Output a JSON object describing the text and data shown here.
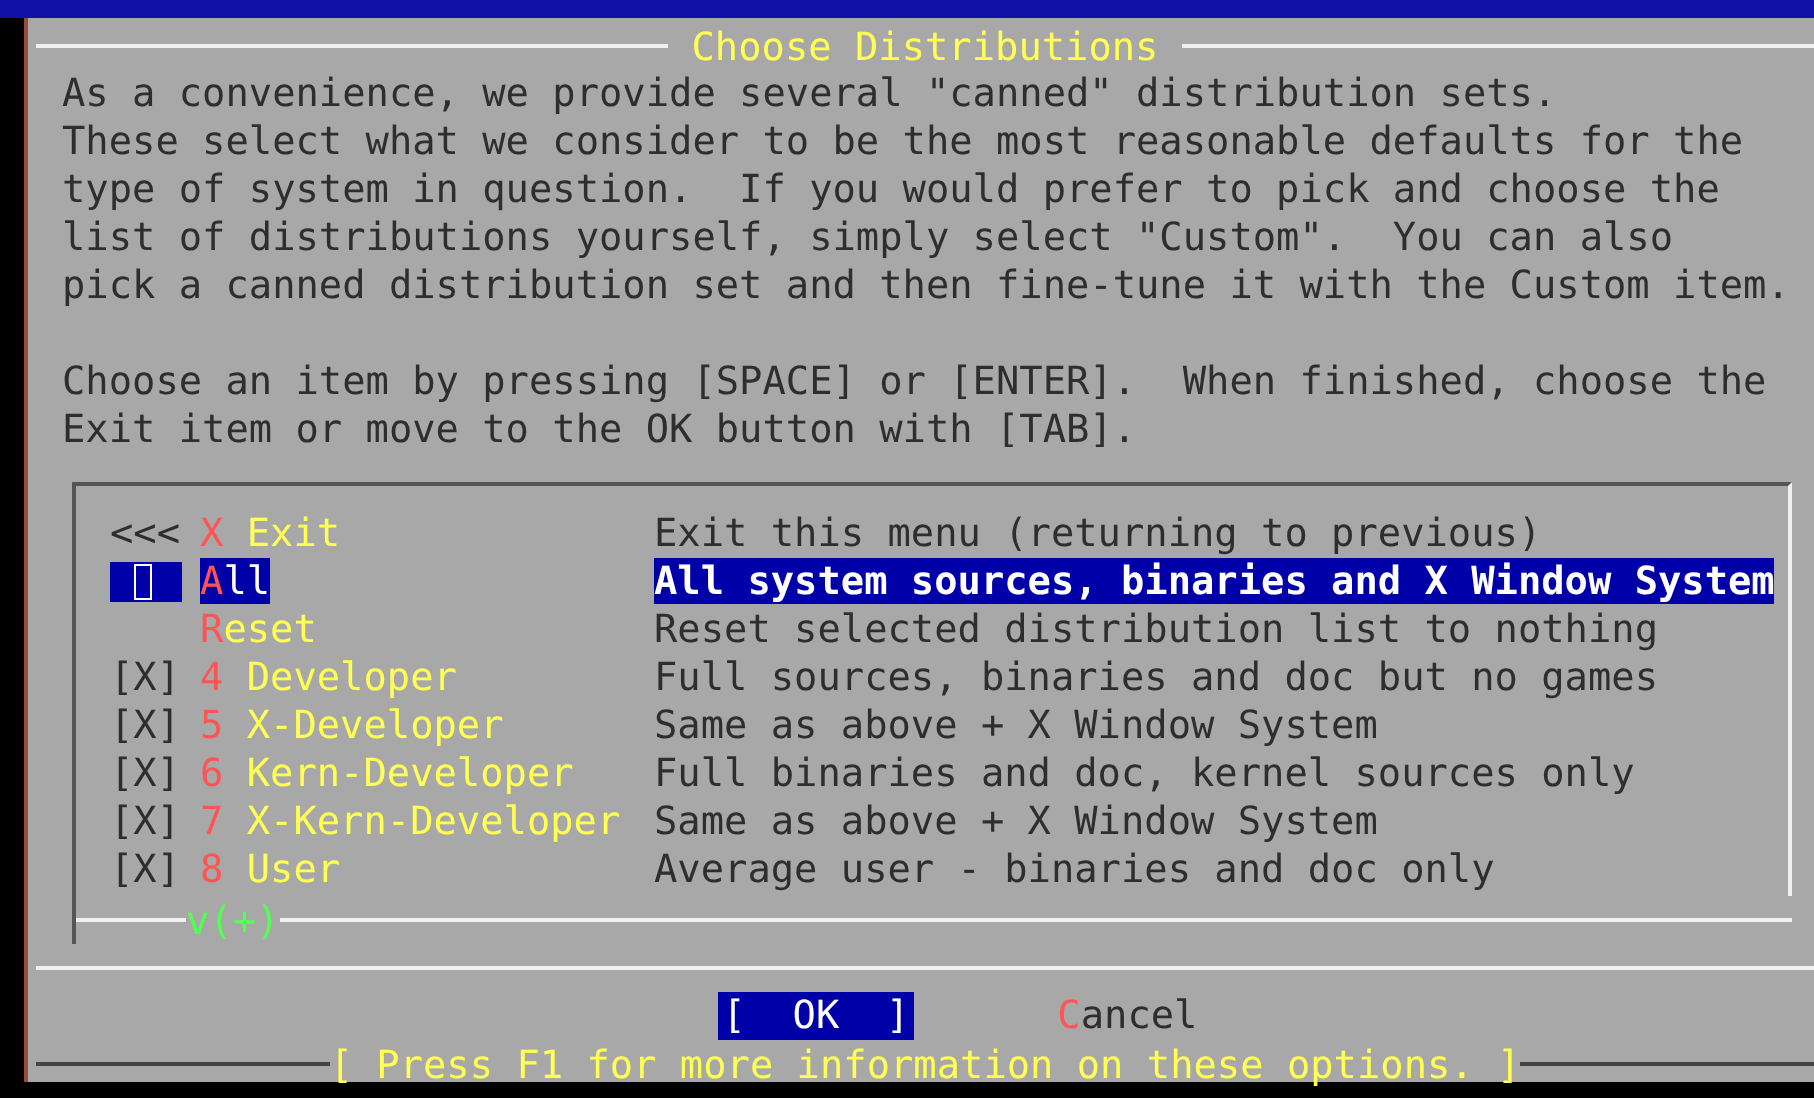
{
  "dialog": {
    "title": "Choose Distributions",
    "message": [
      [
        "As a convenience, we provide several \"canned\" distribution sets.",
        "These select what we consider to be the most reasonable defaults for the",
        "type of system in question.  If you would prefer to pick and choose the",
        "list of distributions yourself, simply select \"Custom\".  You can also",
        "pick a canned distribution set and then fine-tune it with the Custom item."
      ],
      [
        "Choose an item by pressing [SPACE] or [ENTER].  When finished, choose the",
        "Exit item or move to the OK button with [TAB]."
      ]
    ],
    "menu": {
      "items": [
        {
          "marker": "<<<",
          "name": "X Exit",
          "description": "Exit this menu (returning to previous)",
          "selected": false
        },
        {
          "name": "All",
          "description": "All system sources, binaries and X Window System",
          "selected": true
        },
        {
          "name": "Reset",
          "description": "Reset selected distribution list to nothing",
          "selected": false
        },
        {
          "marker": "[X]",
          "name": "4 Developer",
          "description": "Full sources, binaries and doc but no games",
          "selected": false
        },
        {
          "marker": "[X]",
          "name": "5 X-Developer",
          "description": "Same as above + X Window System",
          "selected": false
        },
        {
          "marker": "[X]",
          "name": "6 Kern-Developer",
          "description": "Full binaries and doc, kernel sources only",
          "selected": false
        },
        {
          "marker": "[X]",
          "name": "7 X-Kern-Developer",
          "description": "Same as above + X Window System",
          "selected": false
        },
        {
          "marker": "[X]",
          "name": "8 User",
          "description": "Average user - binaries and doc only",
          "selected": false
        }
      ],
      "scroll_indicator": "v(+)"
    },
    "buttons": [
      {
        "label": "[  OK  ]",
        "selected": true
      },
      {
        "label": "Cancel",
        "selected": false
      }
    ],
    "help": "[ Press F1 for more information on these options. ]"
  }
}
